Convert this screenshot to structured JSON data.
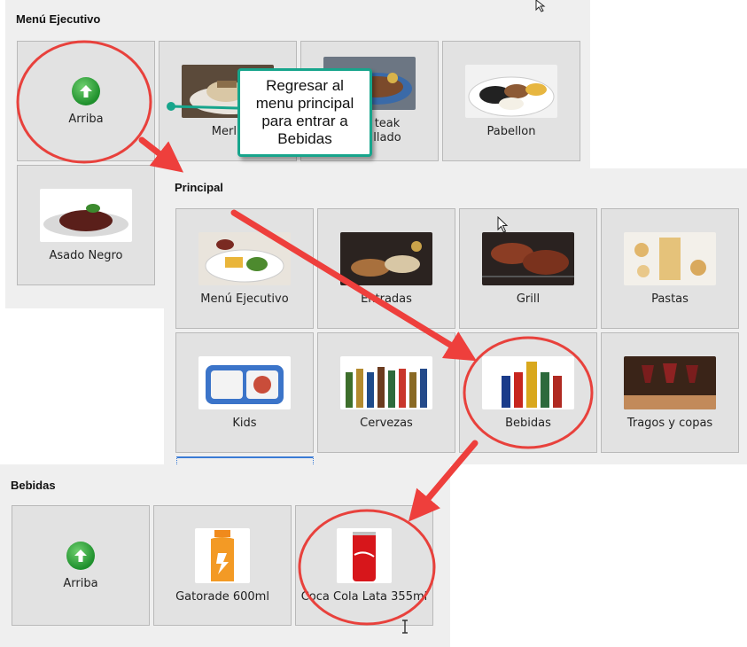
{
  "panels": {
    "ejecutivo": {
      "title": "Menú Ejecutivo",
      "tiles": [
        "Arriba",
        "Merlu",
        "teak\nllado",
        "Pabellon",
        "Asado Negro"
      ]
    },
    "principal": {
      "title": "Principal",
      "tiles": [
        "Menú Ejecutivo",
        "Entradas",
        "Grill",
        "Pastas",
        "Kids",
        "Cervezas",
        "Bebidas",
        "Tragos y copas"
      ]
    },
    "bebidas": {
      "title": "Bebidas",
      "tiles": [
        "Arriba",
        "Gatorade 600ml",
        "Coca Cola Lata 355ml"
      ]
    }
  },
  "callout": {
    "text": "Regresar al\nmenu principal\npara entrar a\nBebidas"
  },
  "icons": [
    "arrow-up-icon",
    "mouse-pointer-icon",
    "text-cursor-icon"
  ],
  "colors": {
    "highlight": "#e8413c",
    "callout_border": "#17a58c",
    "arrow": "#ee3f3c",
    "button_green": "#1e8f2c"
  }
}
